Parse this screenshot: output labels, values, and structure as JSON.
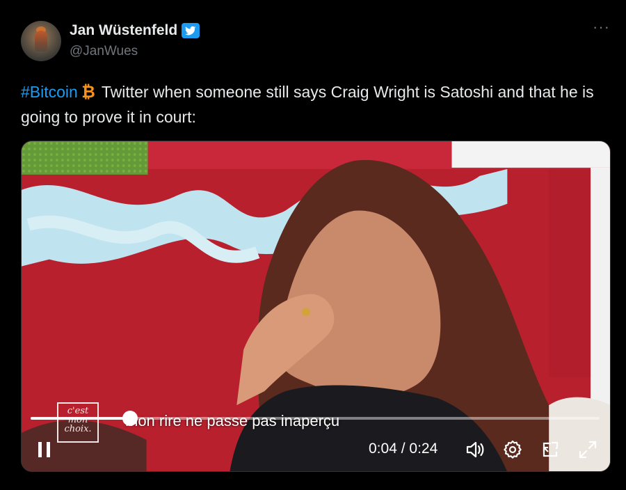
{
  "tweet": {
    "display_name": "Jan Wüstenfeld",
    "handle": "@JanWues",
    "more_icon": "more-icon",
    "hashtag": "#Bitcoin",
    "text_line": "Twitter when someone still says Craig Wright is Satoshi and that he is going to prove it in court:",
    "colors": {
      "hashtag": "#1d9bf0",
      "verified": "#1d9bf0",
      "bitcoin": "#f7931a"
    }
  },
  "video": {
    "subtitle": "mon rire ne passe pas inaperçu",
    "logo_text": [
      "c'est",
      "mon",
      "choix."
    ],
    "current_time": "0:04",
    "time_separator": "/",
    "duration": "0:24",
    "progress": 0.175,
    "controls": [
      "pause-icon",
      "volume-icon",
      "settings-icon",
      "pop-out-icon",
      "fullscreen-icon"
    ]
  }
}
